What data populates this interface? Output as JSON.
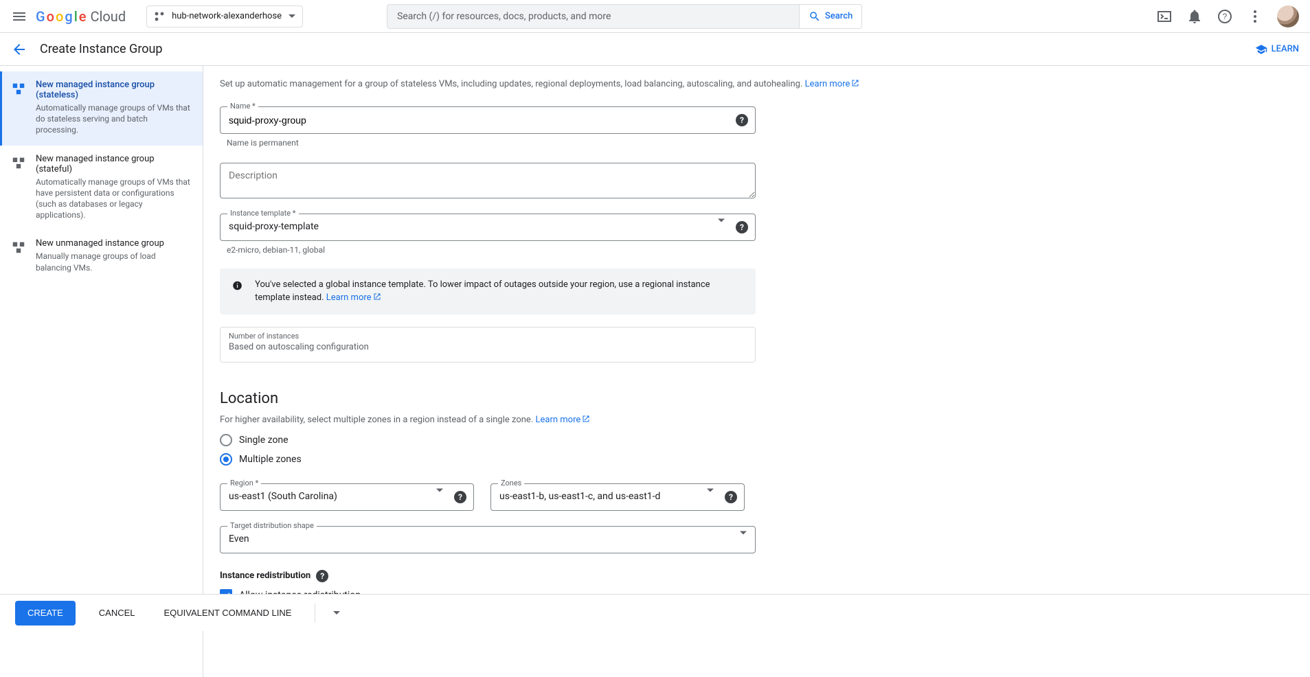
{
  "topbar": {
    "search_placeholder": "Search (/) for resources, docs, products, and more",
    "search_button": "Search",
    "logo": {
      "word1_letters": [
        "G",
        "o",
        "o",
        "g",
        "l",
        "e"
      ],
      "word2": "Cloud"
    },
    "project_name": "hub-network-alexanderhose"
  },
  "subheader": {
    "title": "Create Instance Group",
    "learn": "LEARN"
  },
  "sidebar": [
    {
      "title": "New managed instance group (stateless)",
      "desc": "Automatically manage groups of VMs that do stateless serving and batch processing.",
      "selected": true
    },
    {
      "title": "New managed instance group (stateful)",
      "desc": "Automatically manage groups of VMs that have persistent data or configurations (such as databases or legacy applications).",
      "selected": false
    },
    {
      "title": "New unmanaged instance group",
      "desc": "Manually manage groups of load balancing VMs.",
      "selected": false
    }
  ],
  "form": {
    "intro": "Set up automatic management for a group of stateless VMs, including updates, regional deployments, load balancing, autoscaling, and autohealing. ",
    "learn_more": "Learn more",
    "name": {
      "label": "Name *",
      "value": "squid-proxy-group",
      "helper": "Name is permanent"
    },
    "description": {
      "label": "Description"
    },
    "instance_template": {
      "label": "Instance template *",
      "value": "squid-proxy-template",
      "helper": "e2-micro, debian-11, global"
    },
    "info_banner": "You've selected a global instance template. To lower impact of outages outside your region, use a regional instance template instead. ",
    "num_instances": {
      "label": "Number of instances",
      "value": "Based on autoscaling configuration"
    },
    "location": {
      "heading": "Location",
      "intro": "For higher availability, select multiple zones in a region instead of a single zone. ",
      "single": "Single zone",
      "multiple": "Multiple zones",
      "region": {
        "label": "Region *",
        "value": "us-east1 (South Carolina)"
      },
      "zones": {
        "label": "Zones",
        "value": "us-east1-b, us-east1-c, and us-east1-d"
      },
      "shape": {
        "label": "Target distribution shape",
        "value": "Even"
      },
      "redistribution": {
        "heading": "Instance redistribution",
        "checkbox": "Allow instance redistribution"
      }
    }
  },
  "footer": {
    "create": "CREATE",
    "cancel": "CANCEL",
    "cmd": "EQUIVALENT COMMAND LINE"
  }
}
